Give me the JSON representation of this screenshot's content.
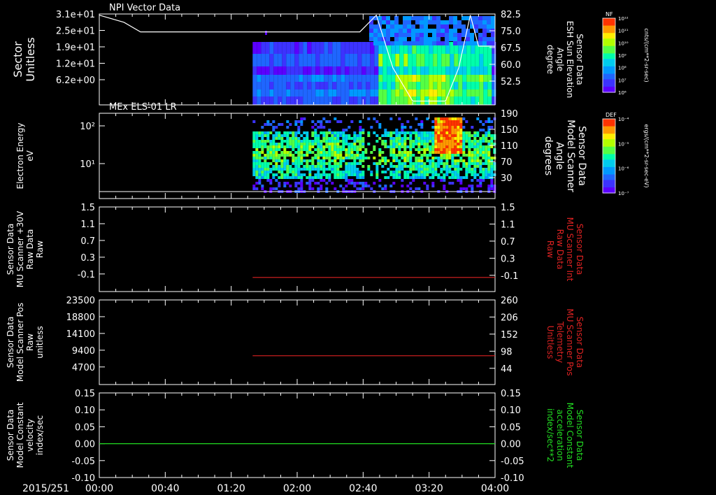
{
  "colors": {
    "background": "#000000",
    "axis": "#ffffff",
    "red_trace": "#dd2222",
    "green_trace": "#22dd22",
    "elevation_trace": "#ffffff"
  },
  "time_axis": {
    "date_label": "2015/251",
    "ticks": [
      "00:00",
      "00:40",
      "01:20",
      "02:00",
      "02:40",
      "03:20",
      "04:00"
    ]
  },
  "colorbars": [
    {
      "tag": "NF",
      "unit": "cnts/(cm**2-sr-sec)",
      "ticks": [
        "10¹²",
        "10¹¹",
        "10¹⁰",
        "10⁹",
        "10⁸",
        "10⁷",
        "10⁶"
      ]
    },
    {
      "tag": "DEF",
      "unit": "ergs/(cm**2-sr-sec-eV)",
      "ticks": [
        "10⁻⁴",
        "10⁻⁵",
        "10⁻⁶",
        "10⁻⁷"
      ]
    }
  ],
  "chart_data": [
    {
      "type": "heatmap",
      "title": "NPI Vector Data",
      "ylabel_lines": [
        "Sector",
        "Unitless"
      ],
      "yticks": [
        "3.1e+01",
        "2.5e+01",
        "1.9e+01",
        "1.2e+01",
        "6.2e+00"
      ],
      "y2label_lines": [
        "Sensor Data",
        "ESH Sun Elevation",
        "Angle",
        "degree"
      ],
      "y2ticks": [
        "82.5",
        "75.0",
        "67.5",
        "60.0",
        "52.5"
      ],
      "colorbar": "NF",
      "data_start": "01:33",
      "elevation_series": {
        "name": "ESH Sun Elevation Angle",
        "x": [
          "00:00",
          "00:15",
          "00:25",
          "00:40",
          "01:20",
          "02:00",
          "02:38",
          "02:48",
          "02:58",
          "03:10",
          "03:20",
          "03:30",
          "03:38",
          "03:45",
          "03:50",
          "04:00"
        ],
        "y": [
          82.0,
          79.0,
          75.0,
          75.0,
          75.0,
          75.0,
          75.0,
          82.0,
          60.0,
          46.0,
          46.0,
          46.0,
          60.0,
          82.0,
          69.0,
          69.0
        ]
      }
    },
    {
      "type": "heatmap",
      "title": "MEx ELS-01 LR",
      "ylabel_lines": [
        "Electron Energy",
        "eV"
      ],
      "yticks": [
        "10²",
        "10¹"
      ],
      "y2label_lines": [
        "Sensor Data",
        "Model Scanner",
        "Angle",
        "degrees"
      ],
      "y2ticks": [
        "190",
        "150",
        "110",
        "70",
        "30"
      ],
      "colorbar": "DEF",
      "data_start": "01:33",
      "scanner_angle_series": {
        "name": "Model Scanner Angle",
        "x": [
          "00:00",
          "04:00"
        ],
        "y": [
          10,
          10
        ]
      }
    },
    {
      "type": "line",
      "ylabel_lines": [
        "Sensor Data",
        "MU Scanner +30V",
        "Raw Data",
        "Raw"
      ],
      "yticks": [
        "1.5",
        "1.1",
        "0.7",
        "0.3",
        "-0.1"
      ],
      "y2label_lines": [
        "Sensor Data",
        "MU Scanner Int",
        "Raw Data",
        "Raw"
      ],
      "y2ticks": [
        "1.5",
        "1.1",
        "0.7",
        "0.3",
        "-0.1"
      ],
      "ylim": [
        -0.3,
        1.5
      ],
      "series": [
        {
          "x": [
            "01:33",
            "04:00"
          ],
          "y": [
            0.0,
            0.0
          ],
          "color": "#dd2222"
        }
      ]
    },
    {
      "type": "line",
      "ylabel_lines": [
        "Sensor Data",
        "Model Scanner Pos",
        "Raw",
        "unitless"
      ],
      "yticks": [
        "23500",
        "18800",
        "14100",
        "9400",
        "4700"
      ],
      "y2label_lines": [
        "Sensor Data",
        "MU Scanner Pos",
        "Telemetry",
        "Unitless"
      ],
      "y2ticks": [
        "260",
        "206",
        "152",
        "98",
        "44"
      ],
      "ylim": [
        0,
        23500
      ],
      "series": [
        {
          "x": [
            "01:33",
            "04:00"
          ],
          "y": [
            8000,
            8000
          ],
          "color": "#dd2222"
        }
      ]
    },
    {
      "type": "line",
      "ylabel_lines": [
        "Sensor Data",
        "Model Constant",
        "velocity",
        "index/sec"
      ],
      "yticks": [
        "0.15",
        "0.10",
        "0.05",
        "0.00",
        "-0.05",
        "-0.10"
      ],
      "y2label_lines": [
        "Sensor Data",
        "Model Constant",
        "acceleration",
        "index/sec**2"
      ],
      "y2ticks": [
        "0.15",
        "0.10",
        "0.05",
        "0.00",
        "-0.05",
        "-0.10"
      ],
      "ylim": [
        -0.1,
        0.15
      ],
      "series": [
        {
          "x": [
            "00:00",
            "04:00"
          ],
          "y": [
            0.0,
            0.0
          ],
          "color": "#22dd22"
        }
      ]
    }
  ]
}
